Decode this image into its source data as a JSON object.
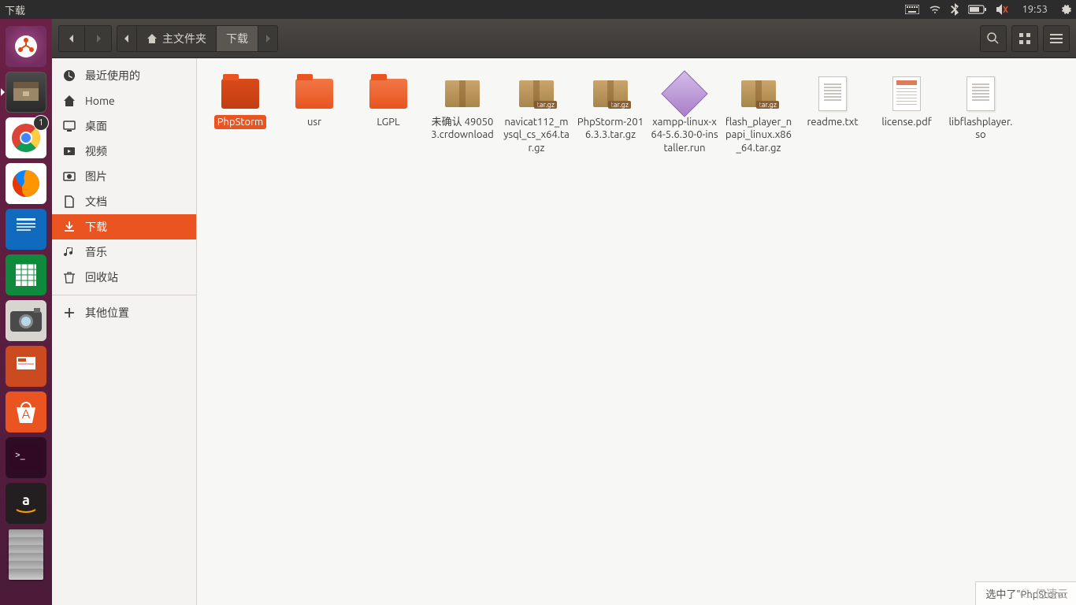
{
  "panel": {
    "window_title": "下载",
    "time": "19:53"
  },
  "launcher": {
    "chrome_badge": "1"
  },
  "pathbar": {
    "home": "主文件夹",
    "current": "下载"
  },
  "sidebar": {
    "recent": "最近使用的",
    "home": "Home",
    "desktop": "桌面",
    "videos": "视频",
    "pictures": "图片",
    "documents": "文档",
    "downloads": "下载",
    "music": "音乐",
    "trash": "回收站",
    "other": "其他位置"
  },
  "files": [
    {
      "name": "PhpStorm",
      "type": "folder",
      "selected": true
    },
    {
      "name": "usr",
      "type": "folder"
    },
    {
      "name": "LGPL",
      "type": "folder"
    },
    {
      "name": "未确认 490503.crdownload",
      "type": "box"
    },
    {
      "name": "navicat112_mysql_cs_x64.tar.gz",
      "type": "targz"
    },
    {
      "name": "PhpStorm-2016.3.3.tar.gz",
      "type": "targz"
    },
    {
      "name": "xampp-linux-x64-5.6.30-0-installer.run",
      "type": "run"
    },
    {
      "name": "flash_player_npapi_linux.x86_64.tar.gz",
      "type": "targz"
    },
    {
      "name": "readme.txt",
      "type": "doc"
    },
    {
      "name": "license.pdf",
      "type": "pdf"
    },
    {
      "name": "libflashplayer.so",
      "type": "doc"
    }
  ],
  "status": {
    "selection": "选中了\"PhpStorm"
  },
  "watermark": "亿速云",
  "tar_label": "tar.gz"
}
